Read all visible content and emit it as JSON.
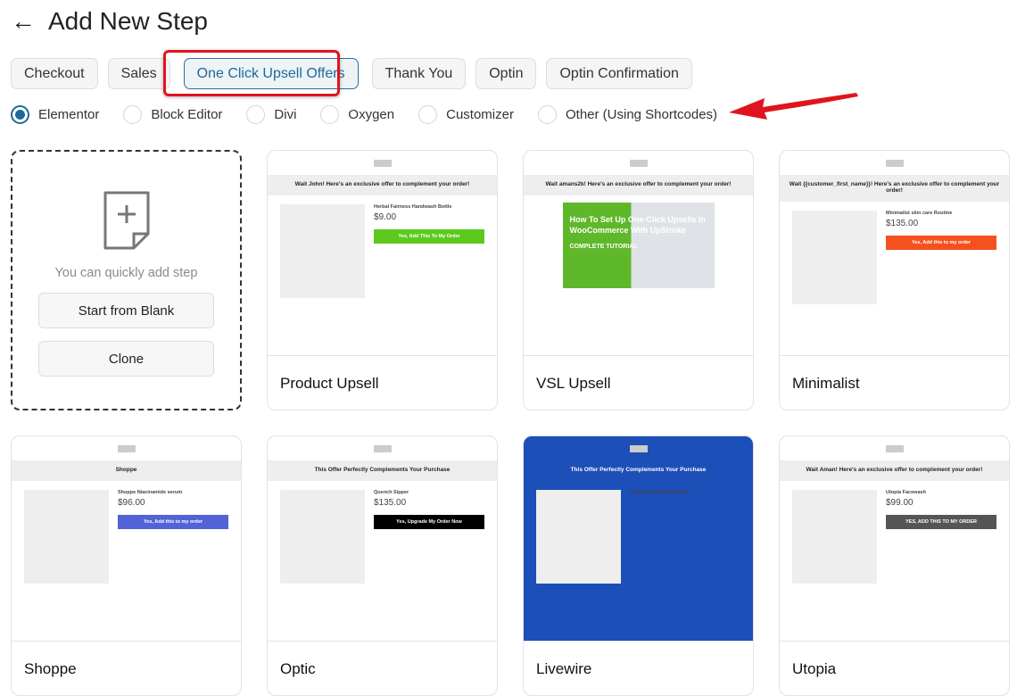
{
  "header": {
    "title": "Add New Step",
    "back_icon": "arrow-left-icon"
  },
  "tabs": [
    {
      "label": "Checkout"
    },
    {
      "label": "Sales"
    },
    {
      "label": "One Click Upsell Offers",
      "active": true
    },
    {
      "label": "Thank You"
    },
    {
      "label": "Optin"
    },
    {
      "label": "Optin Confirmation"
    }
  ],
  "builders": [
    {
      "label": "Elementor",
      "selected": true
    },
    {
      "label": "Block Editor"
    },
    {
      "label": "Divi"
    },
    {
      "label": "Oxygen"
    },
    {
      "label": "Customizer"
    },
    {
      "label": "Other (Using Shortcodes)"
    }
  ],
  "blank_card": {
    "icon": "add-file-icon",
    "message": "You can quickly add step",
    "start_label": "Start from Blank",
    "clone_label": "Clone"
  },
  "colors": {
    "accent": "#1d6a99",
    "highlight": "#e0141e"
  },
  "templates": [
    {
      "name": "Product Upsell",
      "headline": "Wait John! Here's an exclusive offer to complement your order!",
      "product": "Herbal Fairness Handwash Bottle",
      "price": "$9.00",
      "cta": "Yes, Add This To My Order",
      "cta_color": "#5cc91e",
      "style": "product"
    },
    {
      "name": "VSL Upsell",
      "headline": "Wait amans2k! Here's an exclusive offer to complement your order!",
      "product": "How To Set Up One-Click Upsells In WooCommerce With UpStroke",
      "price": "COMPLETE TUTORIAL",
      "cta": "",
      "cta_color": "#5cc91e",
      "style": "vsl"
    },
    {
      "name": "Minimalist",
      "headline": "Wait {{customer_first_name}}! Here's an exclusive offer to complement your order!",
      "product": "Minimalist skin care Routine",
      "price": "$135.00",
      "cta": "Yes, Add this to my order",
      "cta_color": "#f4511e",
      "style": "product"
    },
    {
      "name": "Shoppe",
      "headline": "Shoppe",
      "product": "Shoppe Niacinamide serum",
      "price": "$96.00",
      "cta": "Yes, Add this to my order",
      "cta_color": "#5163d6",
      "style": "product"
    },
    {
      "name": "Optic",
      "headline": "This Offer Perfectly Complements Your Purchase",
      "product": "Quench Sipper",
      "price": "$135.00",
      "cta": "Yes, Upgrade My Order Now",
      "cta_color": "#000000",
      "style": "product"
    },
    {
      "name": "Livewire",
      "headline": "This Offer Perfectly Complements Your Purchase",
      "product": "Amazing Shampoo Bottle",
      "price": "",
      "cta": "",
      "cta_color": "#1c4fb8",
      "style": "product"
    },
    {
      "name": "Utopia",
      "headline": "Wait Aman! Here's an exclusive offer to complement your order!",
      "product": "Utopia Facewash",
      "price": "$99.00",
      "cta": "YES, ADD THIS TO MY ORDER",
      "cta_color": "#555555",
      "style": "product"
    }
  ]
}
